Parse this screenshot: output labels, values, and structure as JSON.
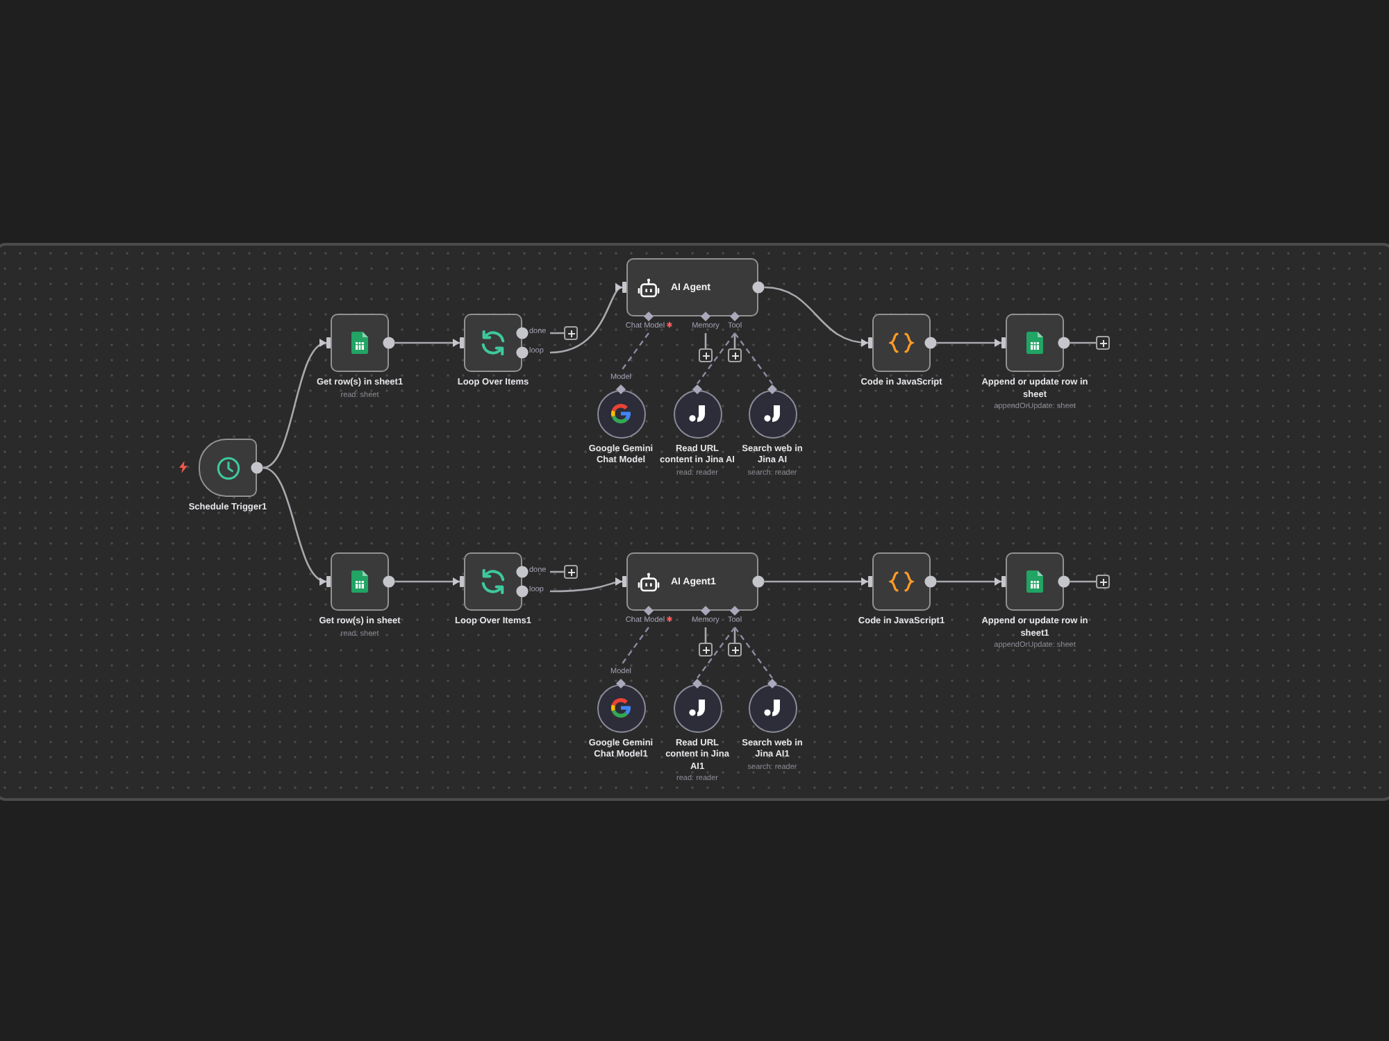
{
  "trigger": {
    "name": "Schedule Trigger1"
  },
  "branches": [
    {
      "nodes": [
        {
          "kind": "sheets",
          "name": "Get row(s) in sheet1",
          "subtitle": "read: sheet"
        },
        {
          "kind": "loop",
          "name": "Loop Over Items",
          "outputs": [
            "done",
            "loop"
          ]
        },
        {
          "kind": "agent",
          "name": "AI Agent",
          "ports": [
            {
              "label": "Chat Model",
              "required": true,
              "add": false
            },
            {
              "label": "Memory",
              "required": false,
              "add": true
            },
            {
              "label": "Tool",
              "required": false,
              "add": true
            }
          ]
        },
        {
          "kind": "code",
          "name": "Code in JavaScript"
        },
        {
          "kind": "sheets",
          "name": "Append or update row in sheet",
          "subtitle": "appendOrUpdate: sheet"
        }
      ],
      "sub_nodes": [
        {
          "kind": "gemini",
          "name": "Google Gemini Chat Model",
          "output_label": "Model"
        },
        {
          "kind": "jina",
          "name": "Read URL content in Jina AI",
          "subtitle": "read: reader"
        },
        {
          "kind": "jina",
          "name": "Search web in Jina AI",
          "subtitle": "search: reader"
        }
      ]
    },
    {
      "nodes": [
        {
          "kind": "sheets",
          "name": "Get row(s) in sheet",
          "subtitle": "read: sheet"
        },
        {
          "kind": "loop",
          "name": "Loop Over Items1",
          "outputs": [
            "done",
            "loop"
          ]
        },
        {
          "kind": "agent",
          "name": "AI Agent1",
          "ports": [
            {
              "label": "Chat Model",
              "required": true,
              "add": false
            },
            {
              "label": "Memory",
              "required": false,
              "add": true
            },
            {
              "label": "Tool",
              "required": false,
              "add": true
            }
          ]
        },
        {
          "kind": "code",
          "name": "Code in JavaScript1"
        },
        {
          "kind": "sheets",
          "name": "Append or update row in sheet1",
          "subtitle": "appendOrUpdate: sheet"
        }
      ],
      "sub_nodes": [
        {
          "kind": "gemini",
          "name": "Google Gemini Chat Model1",
          "output_label": "Model"
        },
        {
          "kind": "jina",
          "name": "Read URL content in Jina AI1",
          "subtitle": "read: reader"
        },
        {
          "kind": "jina",
          "name": "Search web in Jina AI1",
          "subtitle": "search: reader"
        }
      ]
    }
  ]
}
